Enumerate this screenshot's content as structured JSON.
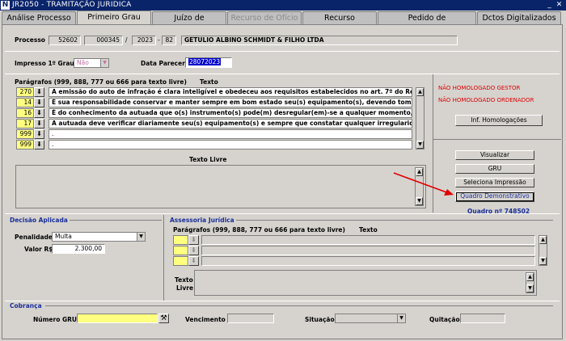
{
  "window": {
    "title": "JR2050 - TRAMITAÇÃO JURIDICA",
    "controls": [
      "_",
      "✕"
    ]
  },
  "tabs": [
    {
      "label": "Análise Processo"
    },
    {
      "label": "Primeiro Grau"
    },
    {
      "label": "Juízo de Retratação"
    },
    {
      "label": "Recurso de Ofício"
    },
    {
      "label": "Recurso"
    },
    {
      "label": "Pedido de Reconsideração"
    },
    {
      "label": "Dctos Digitalizados"
    }
  ],
  "processo": {
    "label": "Processo",
    "p1": "52602",
    "p2": "000345",
    "sep1": "/",
    "year": "2023",
    "sep2": "-",
    "p3": "82",
    "name": "GETULIO ALBINO SCHMIDT & FILHO LTDA"
  },
  "impresso": {
    "label": "Impresso 1º Grau",
    "value": "Não",
    "data_label": "Data Parecer",
    "data_value": "28072023"
  },
  "paragrafos": {
    "label": "Parágrafos (999, 888, 777 ou 666 para texto livre)",
    "texto_label": "Texto",
    "rows": [
      {
        "num": "270",
        "text": "A emissão do auto de infração é clara inteligível e obedeceu aos requisitos estabelecidos no art. 7º do Regulame"
      },
      {
        "num": "14",
        "text": "É sua responsabilidade conservar e manter sempre em bom estado seu(s) equipamento(s), devendo tomar toda"
      },
      {
        "num": "16",
        "text": "É do conhecimento da autuada que o(s) instrumento(s) pode(m) desregular(em)-se a qualquer momento, razão"
      },
      {
        "num": "17",
        "text": "A autuada deve verificar diariamente seu(s) equipamento(s) e sempre que constatar qualquer irregularidade é s"
      },
      {
        "num": "999",
        "text": "."
      },
      {
        "num": "999",
        "text": "."
      }
    ],
    "texto_livre_label": "Texto Livre"
  },
  "status": {
    "line1": "NÃO HOMOLOGADO GESTOR",
    "line2": "NÃO HOMOLOGADO ORDENADOR",
    "inf_button": "Inf. Homologações"
  },
  "actions": {
    "visualizar": "Visualizar",
    "gru": "GRU",
    "seleciona": "Seleciona Impressão",
    "quadro": "Quadro Demonstrativo",
    "quadro_no": "Quadro nº 748502"
  },
  "decisao": {
    "title": "Decisão Aplicada",
    "penalidade_label": "Penalidade",
    "penalidade_value": "Multa",
    "valor_label": "Valor R$",
    "valor_value": "2.300,00"
  },
  "assessoria": {
    "title": "Assessoria Jurídica",
    "paragrafos_label": "Parágrafos (999, 888, 777 ou 666 para texto livre)",
    "texto_label": "Texto",
    "texto_livre_label1": "Texto",
    "texto_livre_label2": "Livre"
  },
  "cobranca": {
    "title": "Cobrança",
    "numero_gru_label": "Número GRU",
    "vencimento_label": "Vencimento",
    "situacao_label": "Situação",
    "quitacao_label": "Quitação"
  },
  "colors": {
    "titlebar": "#0a246a",
    "window_bg": "#d6d3ce",
    "field_yellow": "#ffff80",
    "section_header_blue": "#1a2f9b",
    "status_red": "#e00000",
    "annotation_arrow": "#e00000"
  }
}
